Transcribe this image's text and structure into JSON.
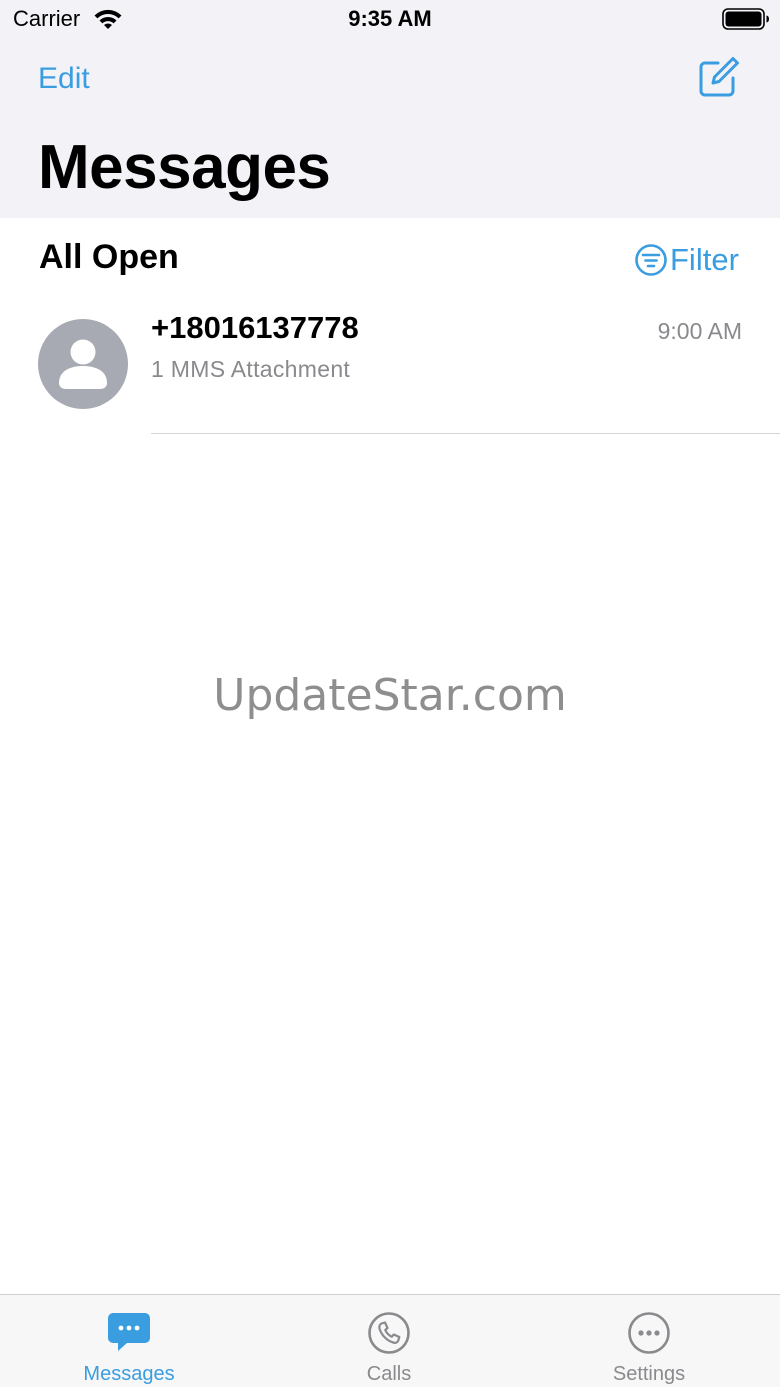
{
  "status_bar": {
    "carrier": "Carrier",
    "time": "9:35 AM"
  },
  "nav": {
    "edit_label": "Edit",
    "title": "Messages"
  },
  "filter_row": {
    "section_title": "All Open",
    "filter_label": "Filter"
  },
  "conversations": [
    {
      "name": "+18016137778",
      "preview": "1 MMS Attachment",
      "time": "9:00 AM"
    }
  ],
  "watermark": "UpdateStar.com",
  "tabs": [
    {
      "label": "Messages",
      "icon": "chat-bubble-icon",
      "active": true
    },
    {
      "label": "Calls",
      "icon": "phone-icon",
      "active": false
    },
    {
      "label": "Settings",
      "icon": "more-icon",
      "active": false
    }
  ],
  "colors": {
    "accent": "#3a9de0",
    "header_background": "#f2f2f7",
    "secondary_text": "#8a8a8e",
    "avatar": "#a7aab2"
  }
}
